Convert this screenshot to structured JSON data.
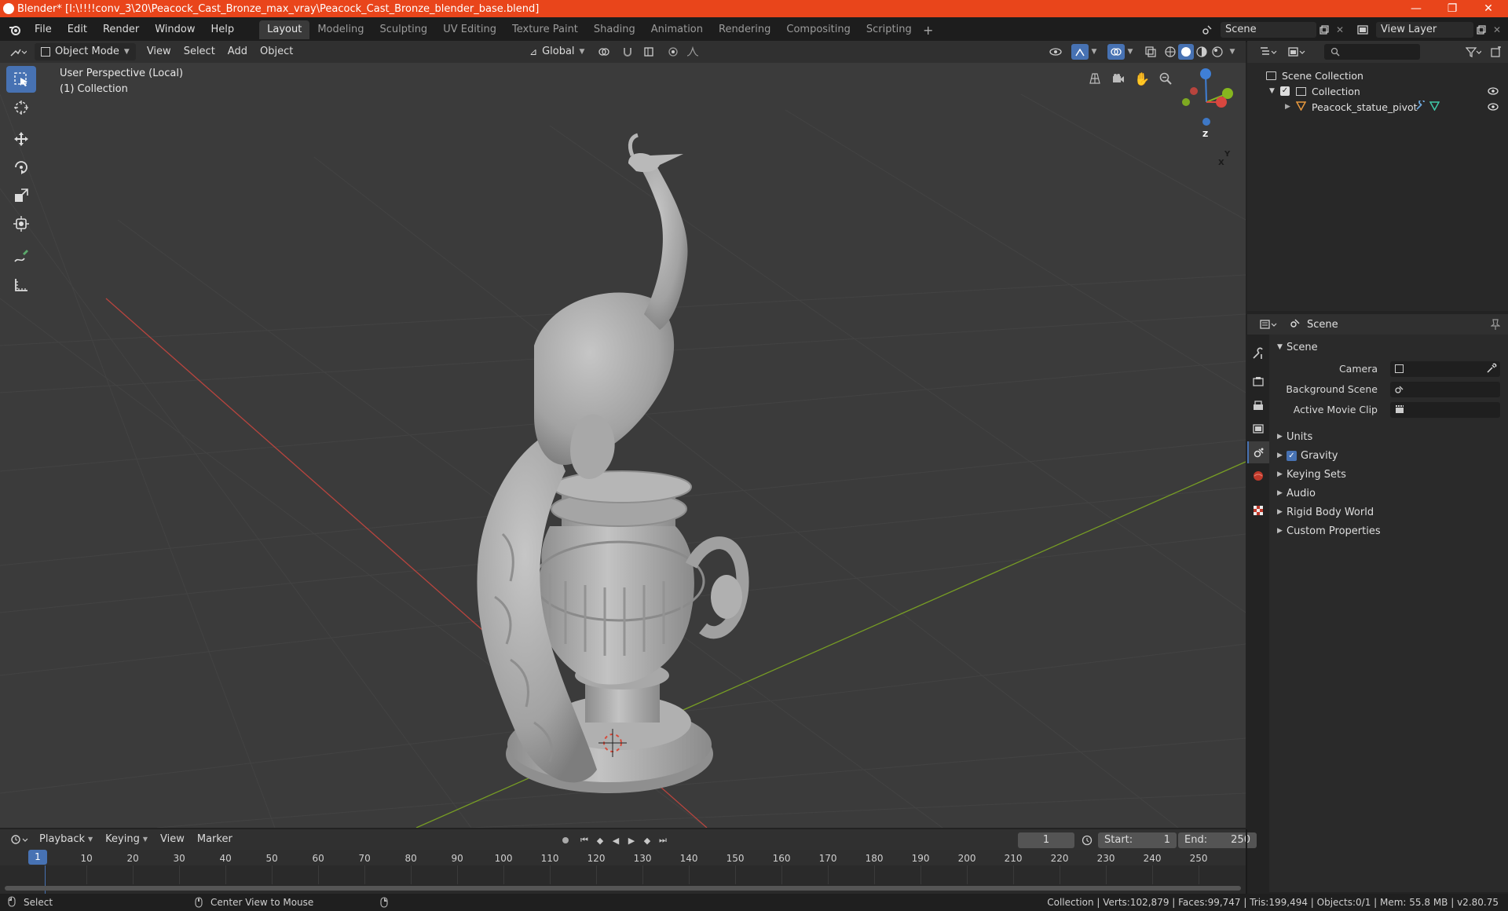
{
  "window": {
    "title": "Blender* [I:\\!!!!conv_3\\20\\Peacock_Cast_Bronze_max_vray\\Peacock_Cast_Bronze_blender_base.blend]",
    "minimize": "—",
    "maximize": "❐",
    "close": "✕"
  },
  "menu": [
    "File",
    "Edit",
    "Render",
    "Window",
    "Help"
  ],
  "workspaces": [
    {
      "label": "Layout",
      "active": true
    },
    {
      "label": "Modeling"
    },
    {
      "label": "Sculpting"
    },
    {
      "label": "UV Editing"
    },
    {
      "label": "Texture Paint"
    },
    {
      "label": "Shading"
    },
    {
      "label": "Animation"
    },
    {
      "label": "Rendering"
    },
    {
      "label": "Compositing"
    },
    {
      "label": "Scripting"
    }
  ],
  "scene_field": "Scene",
  "view_layer_field": "View Layer",
  "viewport_header": {
    "mode": "Object Mode",
    "view": "View",
    "select": "Select",
    "add": "Add",
    "object": "Object",
    "orientation": "Global"
  },
  "viewport": {
    "perspective": "User Perspective (Local)",
    "collection": "(1) Collection",
    "gizmo": {
      "x": "X",
      "y": "Y",
      "z": "Z"
    }
  },
  "outliner": {
    "rows": [
      {
        "label": "Scene Collection"
      },
      {
        "label": "Collection"
      },
      {
        "label": "Peacock_statue_pivot"
      }
    ]
  },
  "properties": {
    "header_title": "Scene",
    "section": "Scene",
    "fields": [
      {
        "label": "Camera"
      },
      {
        "label": "Background Scene"
      },
      {
        "label": "Active Movie Clip"
      }
    ],
    "panels": [
      "Units",
      "Gravity",
      "Keying Sets",
      "Audio",
      "Rigid Body World",
      "Custom Properties"
    ],
    "gravity_checked": true
  },
  "timeline": {
    "menus": [
      "Playback",
      "Keying",
      "View",
      "Marker"
    ],
    "current_frame": "1",
    "start_label": "Start:",
    "start": "1",
    "end_label": "End:",
    "end": "250",
    "ticks": [
      "1",
      "10",
      "20",
      "30",
      "40",
      "50",
      "60",
      "70",
      "80",
      "90",
      "100",
      "110",
      "120",
      "130",
      "140",
      "150",
      "160",
      "170",
      "180",
      "190",
      "200",
      "210",
      "220",
      "230",
      "240",
      "250"
    ]
  },
  "statusbar": {
    "left": "Select",
    "middle": "Center View to Mouse",
    "right": "Collection | Verts:102,879 | Faces:99,747 | Tris:199,494 | Objects:0/1 | Mem: 55.8 MB | v2.80.75"
  },
  "colors": {
    "titlebar": "#e9451b",
    "accent": "#4772b3",
    "x_axis": "#d8473f",
    "y_axis": "#86b61f",
    "z_axis": "#3f7fd6"
  }
}
